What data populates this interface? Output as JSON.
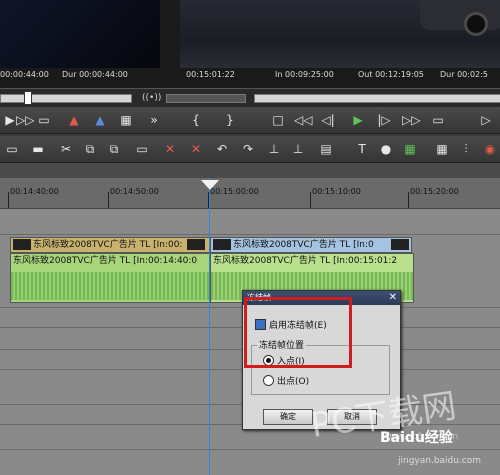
{
  "preview": {
    "left_tc": "00:00:44:00",
    "left_dur_label": "Dur",
    "left_dur": "00:00:44:00",
    "right_tc": "00:15:01:22",
    "right_in_label": "In",
    "right_in": "00:09:25:00",
    "right_out_label": "Out",
    "right_out": "00:12:19:05",
    "right_dur_label": "Dur",
    "right_dur": "00:02:5"
  },
  "timeline": {
    "ruler": [
      "00:14:40:00",
      "00:14:50:00",
      "00:15:00:00",
      "00:15:10:00",
      "00:15:20:00"
    ],
    "clip_left_label": "东风标致2008TVC广告片  TL [In:00:",
    "clip_right_label": "东风标致2008TVC广告片  TL [In:0",
    "audio_left_label": "东风标致2008TVC广告片  TL [In:00:14:40:0",
    "audio_right_label": "东风标致2008TVC广告片  TL [In:00:15:01:2"
  },
  "dialog": {
    "title": "冻结帧",
    "close": "✕",
    "enable_label": "启用冻结帧(E)",
    "group_label": "冻结帧位置",
    "option_in": "入点(I)",
    "option_out": "出点(O)",
    "ok": "确定",
    "cancel": "取消"
  },
  "watermark": {
    "pc": "PC下载网",
    "url": "www.pc6.com.cn",
    "baidu": "Baidu经验",
    "baidu_url": "jingyan.baidu.com"
  },
  "colors": {
    "accent": "#2f86d6",
    "highlight": "#d01c1c",
    "audio_clip": "#a7d57a",
    "video_clip": "#c8b26e"
  }
}
